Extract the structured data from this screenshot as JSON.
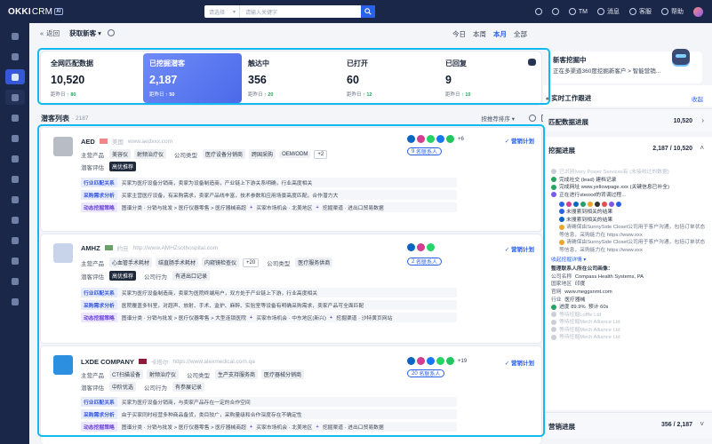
{
  "app": {
    "logo": "OKKI",
    "logo_crm": "CRM",
    "logo_ai": "AI"
  },
  "topbar": {
    "select_label": "请选择",
    "search_placeholder": "请输入关键字",
    "tm": "TM",
    "messages": "消息",
    "service": "客服",
    "help": "帮助"
  },
  "header": {
    "back": "返回",
    "title": "获取新客",
    "ranges": [
      "今日",
      "本周",
      "本月",
      "全部"
    ],
    "active_range": "本月"
  },
  "stats": [
    {
      "label": "全网匹配数据",
      "value": "10,520",
      "delta_label": "距昨日",
      "delta": "↑ 80"
    },
    {
      "label": "已挖掘潜客",
      "value": "2,187",
      "delta_label": "距昨日",
      "delta": "↑ 50",
      "selected": true
    },
    {
      "label": "触达中",
      "value": "356",
      "delta_label": "距昨日",
      "delta": "↑ 20"
    },
    {
      "label": "已打开",
      "value": "60",
      "delta_label": "距昨日",
      "delta": "↑ 12"
    },
    {
      "label": "已回复",
      "value": "9",
      "delta_label": "距昨日",
      "delta": "↑ 10"
    }
  ],
  "list": {
    "title": "潜客列表",
    "count": "· 2187",
    "sort": "按推荐排序"
  },
  "labels": {
    "products": "主营产品",
    "company_type": "公司类型",
    "rating": "潜客评估",
    "behavior": "公司行为",
    "industry_match": "行业匹配关系",
    "purchase": "采购需求分析",
    "dynamic": "动态挖掘策略",
    "contacts_suffix": "名联系人",
    "marketing": "营销计划"
  },
  "cards": [
    {
      "name": "AED",
      "country": "美国",
      "website": "www.aedxxx.com",
      "products": [
        "美容仪",
        "射频治疗仪"
      ],
      "company_type": [
        "医疗设备分销商",
        "跨国采购",
        "OEM/ODM"
      ],
      "company_type_more": "+2",
      "rating": "高优推荐",
      "contacts": "9",
      "extra": "+6",
      "industry": "买家为医疗设备分销商，卖家为设备制造商，产业链上下游关系明确，行业高度相关",
      "purchase": "买家主营医疗设备，有采购需求，卖家产品线丰富，技术参数和应用场景高度匹配，合作潜力大",
      "dyn_1": "图谱分类 · 分销与批发 > 医疗仪器零售 > 医疗器械商超",
      "dyn_2": "买家市场机会 · 北美地区",
      "dyn_3": "挖掘渠道 · 进出口贸易数据"
    },
    {
      "name": "AMHZ",
      "country": "约旦",
      "website": "http://www.AMHZsothospital.com",
      "products": [
        "心血管手术耗材",
        "结直肠手术耗材",
        "内窥镜检查仪"
      ],
      "products_more": "+20",
      "company_type": [
        "医疗服务供商"
      ],
      "rating": "高优推荐",
      "behavior": [
        "有进出口记录"
      ],
      "contacts": "2",
      "extra": "",
      "industry": "买家为医疗设备制造商，卖家为医院终端用户，双方处于产业链上下游，行业高度相关",
      "purchase": "医院覆盖多科室，对超声、放射、手术、监护、麻醉、实验室等设备有明确采购需求，卖家产品可全面匹配",
      "dyn_1": "图谱分类 · 分销与批发 > 医疗仪器零售 > 大型连锁医院",
      "dyn_2": "买家市场机会 · 中东地区(新兴)",
      "dyn_3": "挖掘渠道 · 沙特黄页网站"
    },
    {
      "name": "LXDE COMPANY",
      "country": "卡塔尔",
      "website": "https://www.alexmedical.com.qa",
      "products": [
        "CT扫描设备",
        "射频治疗仪"
      ],
      "company_type": [
        "生产支持服务商",
        "医疗器械分销商"
      ],
      "rating": "中阶优选",
      "behavior": [
        "有参展记录"
      ],
      "contacts": "20",
      "extra": "+19",
      "industry": "买家为医疗设备分销商，与卖家产品存在一定的合作空间",
      "purchase": "由于买家同时经营多种商品备货，类目较广，采购量级和合作深度存在不确定性",
      "dyn_1": "图谱分类 · 分销与批发 > 医疗仪器零售 > 医疗器械商超",
      "dyn_2": "买家市场机会 · 北美地区",
      "dyn_3": "挖掘渠道 · 进出口贸易数据"
    }
  ],
  "right": {
    "notice_title": "新客挖掘中",
    "notice_sub": "正在多渠道360度挖掘新客户 > 智能营销...",
    "work_title": "实时工作跟进",
    "collapse": "收起",
    "match_title": "匹配数据进展",
    "match_count": "10,520",
    "mine_title": "挖掘进展",
    "mine_count": "2,187 / 10,520",
    "steps": [
      {
        "text": "已识别Ivory Power Services有 (未接收过的数据)",
        "state": "faint"
      },
      {
        "text": "完成社交 (lead) 建档记录",
        "state": "done"
      },
      {
        "text": "完成网址 www.yellowpage.xxx (关键信息已补全)",
        "state": "done"
      },
      {
        "text": "正在进行steoxxl的背调过程...",
        "state": "run"
      }
    ],
    "sub_steps": [
      "未搜索到相关的结果",
      "未搜索到相关的结果",
      "请确保由SunnySide Closet公司用于客户沟通，包括订单状态等信息，采购能力在 https://www.xxx",
      "请确保由SunnySide Closet公司用于客户沟通，包括订单状态等信息，采购能力在 https://www.xxx"
    ],
    "collect_label": "收起挖掘详情 ▾",
    "contact_title": "整理联系人所在公司画像：",
    "contact_rows": [
      {
        "k": "公司名称",
        "v": "Compass Health Systems, PA"
      },
      {
        "k": "国家地区",
        "v": "印度"
      },
      {
        "k": "官网",
        "v": "www.meggsnmt.com"
      },
      {
        "k": "行业",
        "v": "医疗器械"
      }
    ],
    "progress_label": "进度 89.9%",
    "progress_eta": "预计 60s",
    "waits": [
      "等待挖掘Lofffe Ltd",
      "等待挖掘Mech Alliance Ltd",
      "等待挖掘Mech Alliance Ltd",
      "等待挖掘Mech Alliance Ltd"
    ],
    "market_title": "营销进展",
    "market_count": "356 / 2,187"
  },
  "colors": {
    "accent": "#2a61e8",
    "highlight_border": "#12b9ee",
    "nav_bg": "#1b2748"
  }
}
